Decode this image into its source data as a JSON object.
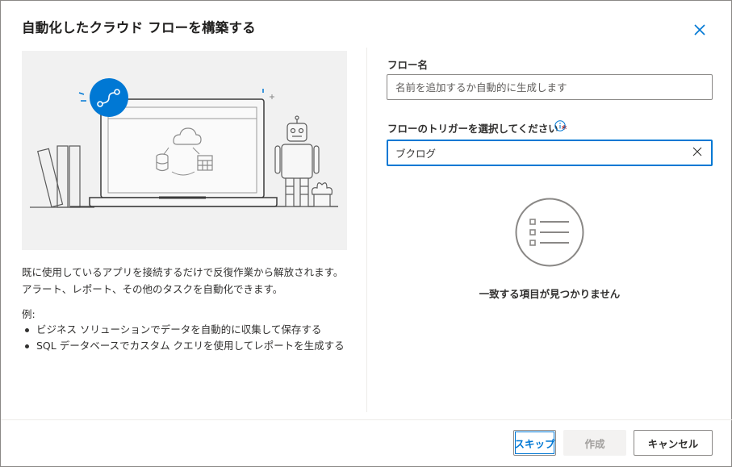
{
  "dialog": {
    "title": "自動化したクラウド フローを構築する"
  },
  "left": {
    "description": "既に使用しているアプリを接続するだけで反復作業から解放されます。アラート、レポート、その他のタスクを自動化できます。",
    "examples_label": "例:",
    "examples": [
      "ビジネス ソリューションでデータを自動的に収集して保存する",
      "SQL データベースでカスタム クエリを使用してレポートを生成する"
    ]
  },
  "form": {
    "flow_name_label": "フロー名",
    "flow_name_placeholder": "名前を追加するか自動的に生成します",
    "flow_name_value": "",
    "trigger_label": "フローのトリガーを選択してください",
    "trigger_required_mark": "*",
    "trigger_search_value": "ブクログ",
    "no_results_text": "一致する項目が見つかりません"
  },
  "footer": {
    "skip_label": "スキップ",
    "create_label": "作成",
    "cancel_label": "キャンセル"
  },
  "colors": {
    "accent": "#0078d4",
    "required": "#a4262c",
    "disabled_text": "#a19f9d"
  },
  "icons": [
    "close-icon",
    "info-icon",
    "clear-icon",
    "list-icon",
    "cloud-icon",
    "database-icon",
    "calendar-icon",
    "flow-icon",
    "robot-icon"
  ]
}
